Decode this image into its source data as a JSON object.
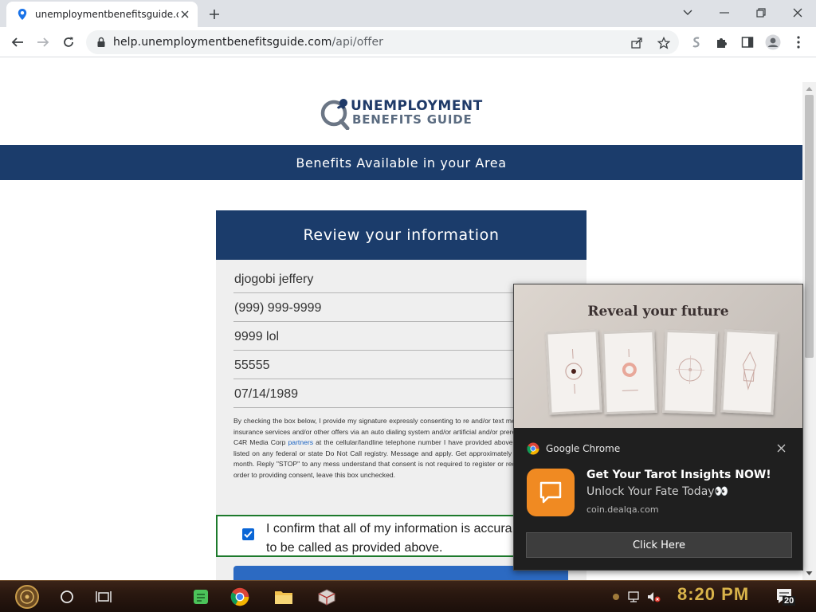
{
  "browser": {
    "tab_title": "unemploymentbenefitsguide.com",
    "url_host": "help.unemploymentbenefitsguide.com",
    "url_path": "/api/offer"
  },
  "page": {
    "logo_line1": "UNEMPLOYMENT",
    "logo_line2": "BENEFITS GUIDE",
    "banner": "Benefits Available in your Area",
    "card_title": "Review your information",
    "fields": {
      "name": "djogobi jeffery",
      "phone": "(999) 999-9999",
      "address": "9999 lol",
      "zip": "55555",
      "dob": "07/14/1989"
    },
    "consent": {
      "part1": "By checking the box below, I provide my signature expressly consenting to re and/or text messages regarding insurance services and/or other offers via an auto dialing system and/or artificial and/or prerecorded calls from C4R Media Corp",
      "link": "partners",
      "part2": "at the cellular/landline telephone number I have provided above, re number being listed on any federal or state Do Not Call registry. Message and apply. Get approximately 30 messages per month. Reply \"STOP\" to any mess understand that consent is not required to register or receive my guide. In order to providing consent, leave this box unchecked."
    },
    "confirm_text": "I confirm that all of my information is accura consent to be called as provided above.",
    "confirm_checked": true
  },
  "notification": {
    "image_headline": "Reveal your future",
    "app_name": "Google Chrome",
    "title": "Get Your Tarot Insights NOW!",
    "body": "Unlock Your Fate Today👀",
    "source": "coin.dealqa.com",
    "button": "Click Here"
  },
  "taskbar": {
    "time": "8:20 PM",
    "notification_count": "20"
  },
  "colors": {
    "navy": "#1b3c6b",
    "green_border": "#1d7a2c",
    "notif_orange": "#f08a22",
    "clock_gold": "#d8b34a"
  }
}
